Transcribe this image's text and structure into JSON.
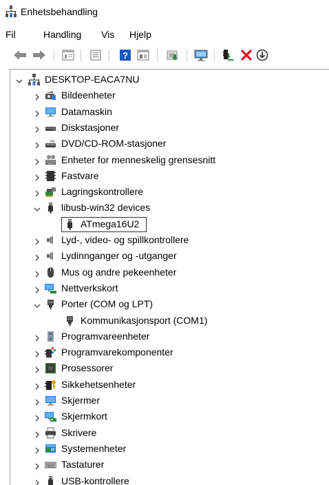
{
  "window": {
    "title": "Enhetsbehandling",
    "icon": "device-manager-icon"
  },
  "menu": {
    "items": [
      "Fil",
      "Handling",
      "Vis",
      "Hjelp"
    ]
  },
  "toolbar": {
    "buttons": [
      "back-arrow-icon",
      "forward-arrow-icon",
      "properties-icon",
      "details-icon",
      "help-icon",
      "view-icon",
      "update-driver-icon",
      "scan-hardware-icon",
      "enable-device-icon",
      "uninstall-icon",
      "download-icon"
    ],
    "colors": {
      "uninstall": "#e81123",
      "help": "#1a57c6",
      "enable": "#2e8b3a"
    }
  },
  "tree": {
    "root": {
      "label": "DESKTOP-EACA7NU",
      "expanded": true,
      "icon": "computer-icon"
    },
    "items": [
      {
        "label": "Bildeenheter",
        "icon": "camera-icon",
        "expanded": false
      },
      {
        "label": "Datamaskin",
        "icon": "monitor-icon",
        "expanded": false
      },
      {
        "label": "Diskstasjoner",
        "icon": "disk-drive-icon",
        "expanded": false
      },
      {
        "label": "DVD/CD-ROM-stasjoner",
        "icon": "dvd-drive-icon",
        "expanded": false
      },
      {
        "label": "Enheter for menneskelig grensesnitt",
        "icon": "hid-icon",
        "expanded": false
      },
      {
        "label": "Fastvare",
        "icon": "firmware-icon",
        "expanded": false
      },
      {
        "label": "Lagringskontrollere",
        "icon": "storage-controller-icon",
        "expanded": false
      },
      {
        "label": "libusb-win32 devices",
        "icon": "usb-plug-icon",
        "expanded": true,
        "children": [
          {
            "label": "ATmega16U2",
            "icon": "usb-plug-icon",
            "selected": true
          }
        ]
      },
      {
        "label": "Lyd-, video- og spillkontrollere",
        "icon": "speaker-icon",
        "expanded": false
      },
      {
        "label": "Lydinnganger og -utganger",
        "icon": "speaker-icon",
        "expanded": false
      },
      {
        "label": "Mus og andre pekeenheter",
        "icon": "mouse-icon",
        "expanded": false
      },
      {
        "label": "Nettverkskort",
        "icon": "network-adapter-icon",
        "expanded": false
      },
      {
        "label": "Porter (COM og LPT)",
        "icon": "port-icon",
        "expanded": true,
        "children": [
          {
            "label": "Kommunikasjonsport (COM1)",
            "icon": "port-icon",
            "selected": false
          }
        ]
      },
      {
        "label": "Programvareenheter",
        "icon": "software-device-icon",
        "expanded": false
      },
      {
        "label": "Programvarekomponenter",
        "icon": "software-component-icon",
        "expanded": false
      },
      {
        "label": "Prosessorer",
        "icon": "processor-icon",
        "expanded": false
      },
      {
        "label": "Sikkehetsenheter",
        "icon": "security-device-icon",
        "expanded": false
      },
      {
        "label": "Skjermer",
        "icon": "monitor-icon",
        "expanded": false
      },
      {
        "label": "Skjermkort",
        "icon": "display-adapter-icon",
        "expanded": false
      },
      {
        "label": "Skrivere",
        "icon": "printer-icon",
        "expanded": false
      },
      {
        "label": "Systemenheter",
        "icon": "system-device-icon",
        "expanded": false
      },
      {
        "label": "Tastaturer",
        "icon": "keyboard-icon",
        "expanded": false
      },
      {
        "label": "USB-kontrollere",
        "icon": "usb-plug-icon",
        "expanded": false
      }
    ]
  }
}
